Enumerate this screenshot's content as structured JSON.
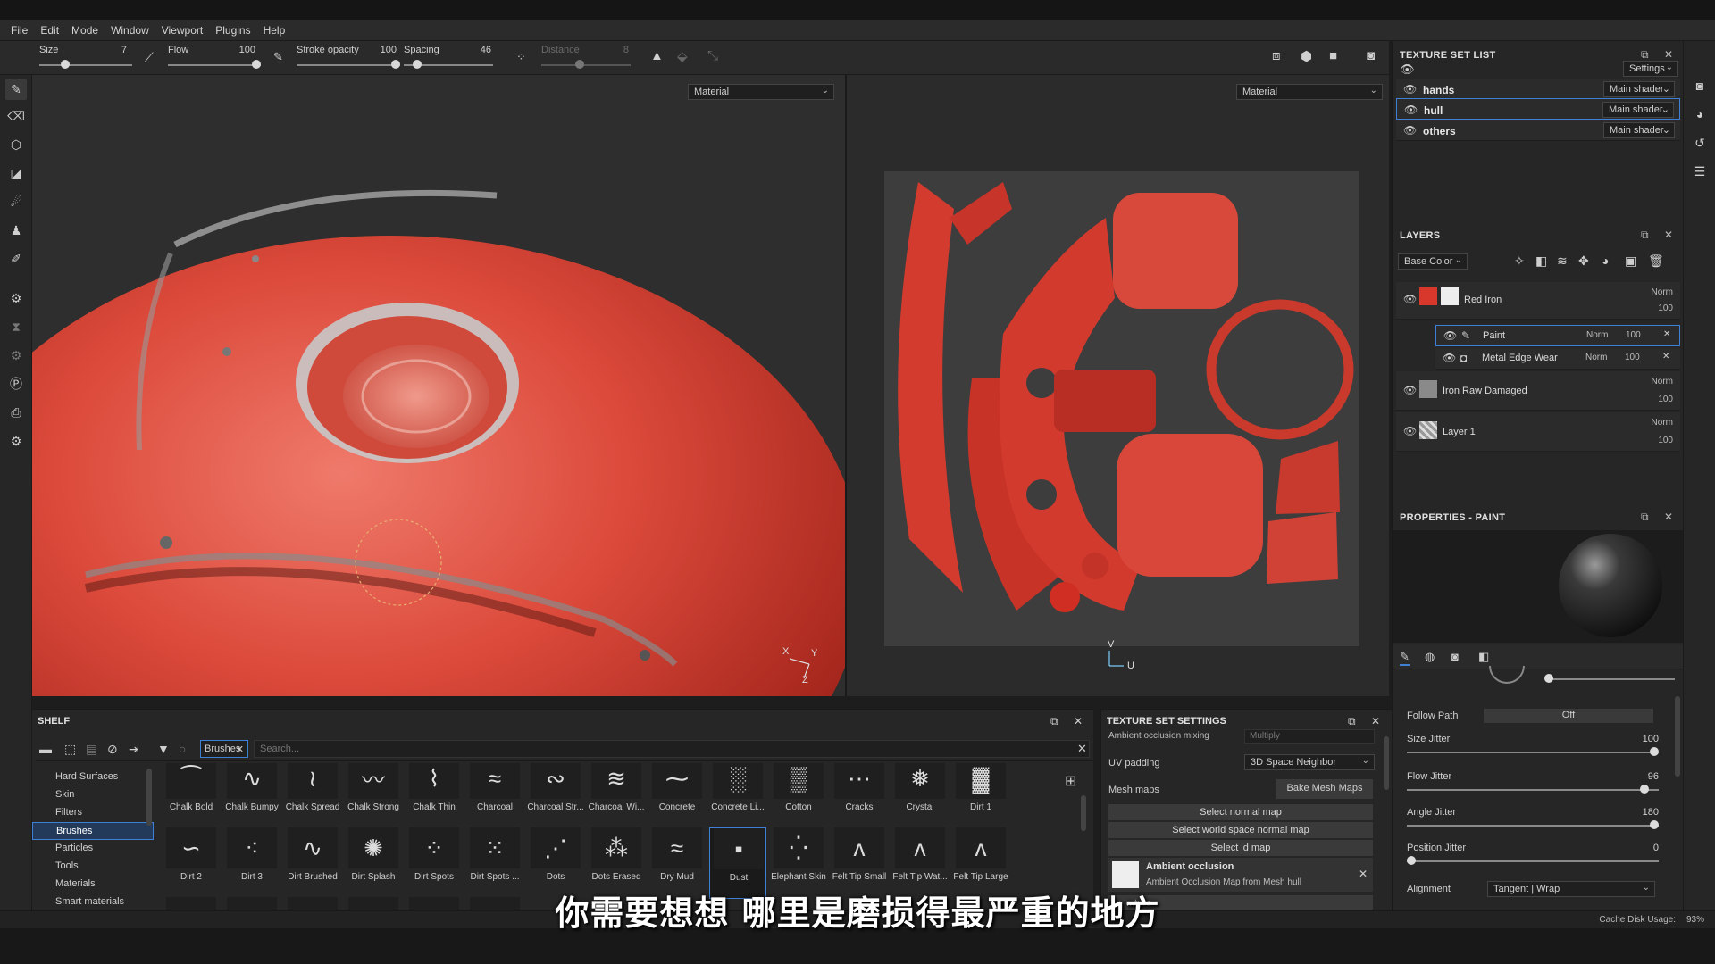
{
  "menu": [
    "File",
    "Edit",
    "Mode",
    "Window",
    "Viewport",
    "Plugins",
    "Help"
  ],
  "toolbar": {
    "size": {
      "label": "Size",
      "value": "7",
      "fraction": 0.1
    },
    "flow": {
      "label": "Flow",
      "value": "100",
      "fraction": 1.0
    },
    "stroke_opacity": {
      "label": "Stroke opacity",
      "value": "100",
      "fraction": 1.0
    },
    "spacing": {
      "label": "Spacing",
      "value": "46",
      "fraction": 0.1
    },
    "distance": {
      "label": "Distance",
      "value": "8",
      "fraction": 0.1
    }
  },
  "viewport": {
    "left_mode": "Material",
    "right_mode": "Material",
    "axis_x": "X",
    "axis_y": "Y",
    "axis_z": "Z",
    "uv_v": "V",
    "uv_u": "U"
  },
  "texture_set_list": {
    "title": "TEXTURE SET LIST",
    "settings_label": "Settings",
    "items": [
      {
        "name": "hands",
        "shader": "Main shader"
      },
      {
        "name": "hull",
        "shader": "Main shader"
      },
      {
        "name": "others",
        "shader": "Main shader"
      }
    ]
  },
  "layers": {
    "title": "LAYERS",
    "channel": "Base Color",
    "items": [
      {
        "name": "Red Iron",
        "blend": "Norm",
        "opacity": "100"
      },
      {
        "name": "Paint",
        "blend": "Norm",
        "opacity": "100"
      },
      {
        "name": "Metal Edge Wear",
        "blend": "Norm",
        "opacity": "100"
      },
      {
        "name": "Iron Raw Damaged",
        "blend": "Norm",
        "opacity": "100"
      },
      {
        "name": "Layer 1",
        "blend": "Norm",
        "opacity": "100"
      }
    ]
  },
  "properties": {
    "title": "PROPERTIES - PAINT",
    "follow_path": {
      "label": "Follow Path",
      "value": "Off"
    },
    "size_jitter": {
      "label": "Size Jitter",
      "value": "100",
      "fraction": 1.0
    },
    "flow_jitter": {
      "label": "Flow Jitter",
      "value": "96",
      "fraction": 0.96
    },
    "angle_jitter": {
      "label": "Angle Jitter",
      "value": "180",
      "fraction": 1.0
    },
    "position_jitter": {
      "label": "Position Jitter",
      "value": "0",
      "fraction": 0.0
    },
    "alignment": {
      "label": "Alignment",
      "value": "Tangent | Wrap"
    }
  },
  "shelf": {
    "title": "SHELF",
    "filter_tag": "Brushes",
    "search_placeholder": "Search...",
    "categories": [
      "Hard Surfaces",
      "Skin",
      "Filters",
      "Brushes",
      "Particles",
      "Tools",
      "Materials",
      "Smart materials"
    ],
    "brushes_row1": [
      "Chalk Bold",
      "Chalk Bumpy",
      "Chalk Spread",
      "Chalk Strong",
      "Chalk Thin",
      "Charcoal",
      "Charcoal Str...",
      "Charcoal Wi...",
      "Concrete",
      "Concrete Li...",
      "Cotton",
      "Cracks",
      "Crystal",
      "Dirt 1"
    ],
    "brushes_row2": [
      "Dirt 2",
      "Dirt 3",
      "Dirt Brushed",
      "Dirt Splash",
      "Dirt Spots",
      "Dirt Spots ...",
      "Dots",
      "Dots Erased",
      "Dry Mud",
      "Dust",
      "Elephant Skin",
      "Felt Tip Small",
      "Felt Tip Wat...",
      "Felt Tip Large"
    ]
  },
  "texture_set_settings": {
    "title": "TEXTURE SET SETTINGS",
    "ao_mixing_label": "Ambient occlusion mixing",
    "ao_mixing_value": "Multiply",
    "uv_padding_label": "UV padding",
    "uv_padding_value": "3D Space Neighbor",
    "mesh_maps_label": "Mesh maps",
    "bake_button": "Bake Mesh Maps",
    "select_normal": "Select normal map",
    "select_world_normal": "Select world space normal map",
    "select_id": "Select id map",
    "ao_title": "Ambient occlusion",
    "ao_desc": "Ambient Occlusion Map from Mesh hull",
    "partial": "...ture"
  },
  "status": {
    "cache": "Cache Disk Usage:",
    "cache_value": "93%"
  },
  "subtitle": "你需要想想 哪里是磨损得最严重的地方",
  "colors": {
    "accent": "#3f7fd4",
    "paint_red": "#d8372c"
  }
}
